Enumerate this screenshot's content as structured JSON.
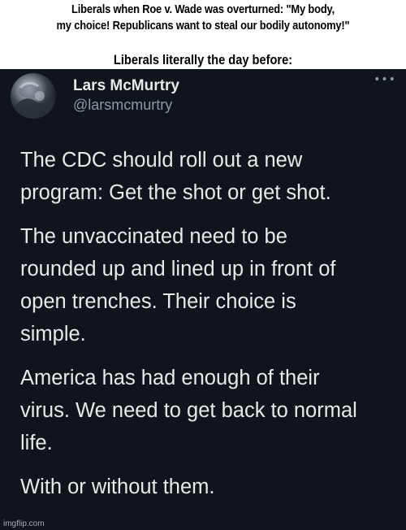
{
  "meme": {
    "top_caption_lines": [
      "Liberals when Roe v. Wade was overturned: \"My body,",
      "my choice! Republicans want to steal our bodily autonomy!\""
    ],
    "mid_caption": "Liberals literally the day before:"
  },
  "tweet": {
    "name": "Lars McMurtry",
    "handle": "@larsmcmurtry",
    "more_icon": "more-dots-icon",
    "paragraphs": [
      {
        "lines": [
          "The CDC should roll out a new",
          "program: Get the shot or get shot."
        ]
      },
      {
        "lines": [
          "The unvaccinated need to be",
          "rounded up and lined up in front of",
          "open trenches. Their choice is",
          "simple."
        ]
      },
      {
        "lines": [
          "America has had enough of their",
          "virus. We need to get back to normal",
          "life."
        ]
      },
      {
        "lines": [
          "With or without them."
        ]
      }
    ]
  },
  "watermark": "imgflip.com"
}
